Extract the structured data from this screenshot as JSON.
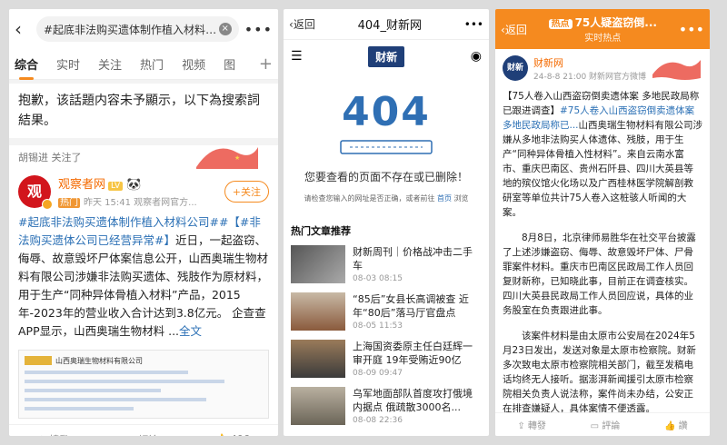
{
  "weibo_search": {
    "back_icon": "chevron-left-icon",
    "query": "#起底非法购买遗体制作植入材料公司",
    "tabs": [
      {
        "label": "综合",
        "active": true
      },
      {
        "label": "实时",
        "active": false
      },
      {
        "label": "关注",
        "active": false
      },
      {
        "label": "热门",
        "active": false
      },
      {
        "label": "视频",
        "active": false
      },
      {
        "label": "图",
        "active": false
      }
    ],
    "notice": "抱歉，该話題内容未予顯示，以下為搜索詞結果。",
    "card": {
      "liked_by": "胡锡进 关注了",
      "user_name": "观察者网",
      "user_level": "LV",
      "avatar_text": "观",
      "hot_tag": "热门",
      "time_source": "昨天 15:41 观察者网官方...",
      "follow_label": "+关注",
      "post_tag1": "#起底非法购买遗体制作植入材料公司#",
      "post_tag2": "#【#非法购买遗体公司已经营异常#】",
      "post_text": "近日，一起盗窃、侮辱、故意毁坏尸体案信息公开，山西奥瑞生物材料有限公司涉嫌非法购买遗体、残肢作为原材料，用于生产“同种异体骨植入材料”产品，2015年-2023年的营业收入合计达到3.8亿元。 企查查APP显示，山西奥瑞生物材料 ...",
      "full_link": "全文",
      "shot_title": "山西奥瑞生物材料有限公司",
      "repost": "轉發",
      "comment": "評論",
      "likes": "406"
    }
  },
  "caixin": {
    "back": "返回",
    "title": "404_财新网",
    "logo": "财新",
    "error_code": "404",
    "message": "您要查看的页面不存在或已删除！",
    "sub_prefix": "请检查您输入的网址是否正确，或者前往",
    "sub_link": "首页",
    "sub_suffix": "浏览",
    "hot_title": "热门文章推荐",
    "news": [
      {
        "title": "财新周刊｜价格战冲击二手车",
        "date": "08-03 08:15"
      },
      {
        "title": "“85后”女县长高调被查 近年“80后”落马厅官盘点",
        "date": "08-05 11:53"
      },
      {
        "title": "上海国资委原主任白廷辉一审开庭 19年受贿近90亿",
        "date": "08-09 09:47"
      },
      {
        "title": "乌军地面部队首度攻打俄境内据点 俄疏散3000名...",
        "date": "08-08 22:36"
      }
    ]
  },
  "weibo_hot": {
    "back": "返回",
    "hot_pill": "热点",
    "title": "75人疑盗窃倒...",
    "subtitle": "实时热点",
    "user_name": "财新网",
    "avatar_text": "财新",
    "meta": "24-8-8 21:00  财新网官方微博",
    "tag_open": "【75人卷入山西盗窃倒卖遗体案 多地民政局称已跟进调查】",
    "tag_inline": "#75人卷入山西盗窃倒卖遗体案 多地民政局称已...",
    "para1": "山西奥瑞生物材料有限公司涉嫌从多地非法购买人体遗体、残肢，用于生产“同种异体骨植入性材料”。来自云南水富市、重庆巴南区、贵州石阡县、四川大英县等地的殡仪馆火化场以及广西桂林医学院解剖教研室等单位共计75人卷入这桩骇人听闻的大案。",
    "para2": "8月8日，北京律师易胜华在社交平台披露了上述涉嫌盗窃、侮辱、故意毁坏尸体、尸骨罪案件材料。重庆市巴南区民政局工作人员回复财新称，已知晓此事，目前正在调查核实。四川大英县民政局工作人员回应说，具体的业务股室在负责跟进此事。",
    "para3": "该案件材料是由太原市公安局在2024年5月23日发出，发送对象是太原市检察院。财新多次致电太原市检察院相关部门，截至发稿电话均终无人接听。据澎湃新闻援引太原市检察院相关负责人说法称，案件尚未办结，公安正在排查嫌疑人，具体案情不便透露。",
    "repost": "轉發",
    "comment": "評論",
    "like": "讚"
  }
}
